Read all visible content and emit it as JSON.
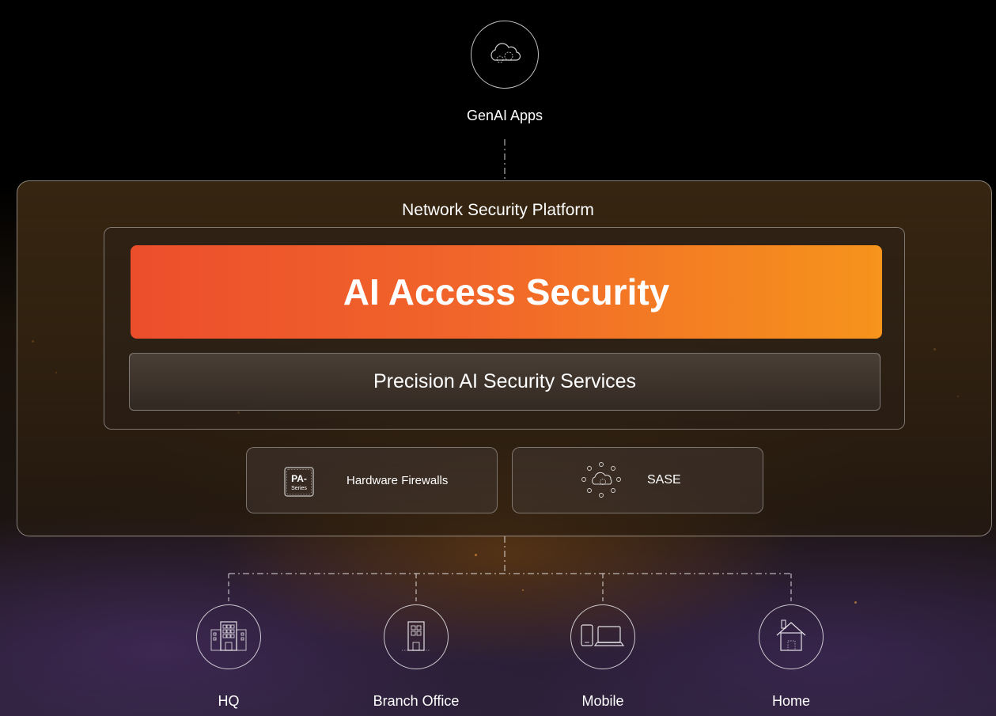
{
  "top_node": {
    "label": "GenAI Apps",
    "icon": "cloud-gear-icon"
  },
  "platform": {
    "title": "Network Security Platform",
    "ai_access": "AI Access Security",
    "precision": "Precision AI Security Services"
  },
  "products": [
    {
      "label": "Hardware Firewalls",
      "icon": "pa-series-icon",
      "icon_text_top": "PA-",
      "icon_text_bottom": "Series"
    },
    {
      "label": "SASE",
      "icon": "sase-cloud-icon"
    }
  ],
  "locations": [
    {
      "label": "HQ",
      "icon": "hq-building-icon"
    },
    {
      "label": "Branch Office",
      "icon": "branch-building-icon"
    },
    {
      "label": "Mobile",
      "icon": "mobile-laptop-icon"
    },
    {
      "label": "Home",
      "icon": "home-icon"
    }
  ],
  "colors": {
    "accent_start": "#ec4e2c",
    "accent_end": "#f6941c",
    "background": "#000000"
  }
}
